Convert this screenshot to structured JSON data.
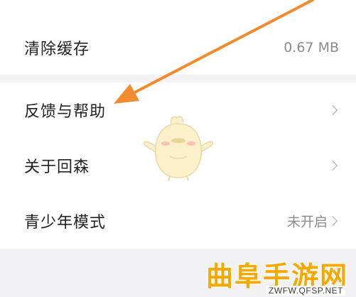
{
  "settings": {
    "cache": {
      "label": "清除缓存",
      "value": "0.67 MB"
    },
    "feedback": {
      "label": "反馈与帮助"
    },
    "about": {
      "label": "关于回森"
    },
    "teen_mode": {
      "label": "青少年模式",
      "value": "未开启"
    }
  },
  "annotation": {
    "color": "#f28a2e"
  },
  "watermark": {
    "title": "曲阜手游网",
    "url": "ZWFW.QFSP.NET",
    "color": "#f5a800"
  },
  "icons": [
    "chevron-right-icon",
    "mascot-icon"
  ]
}
